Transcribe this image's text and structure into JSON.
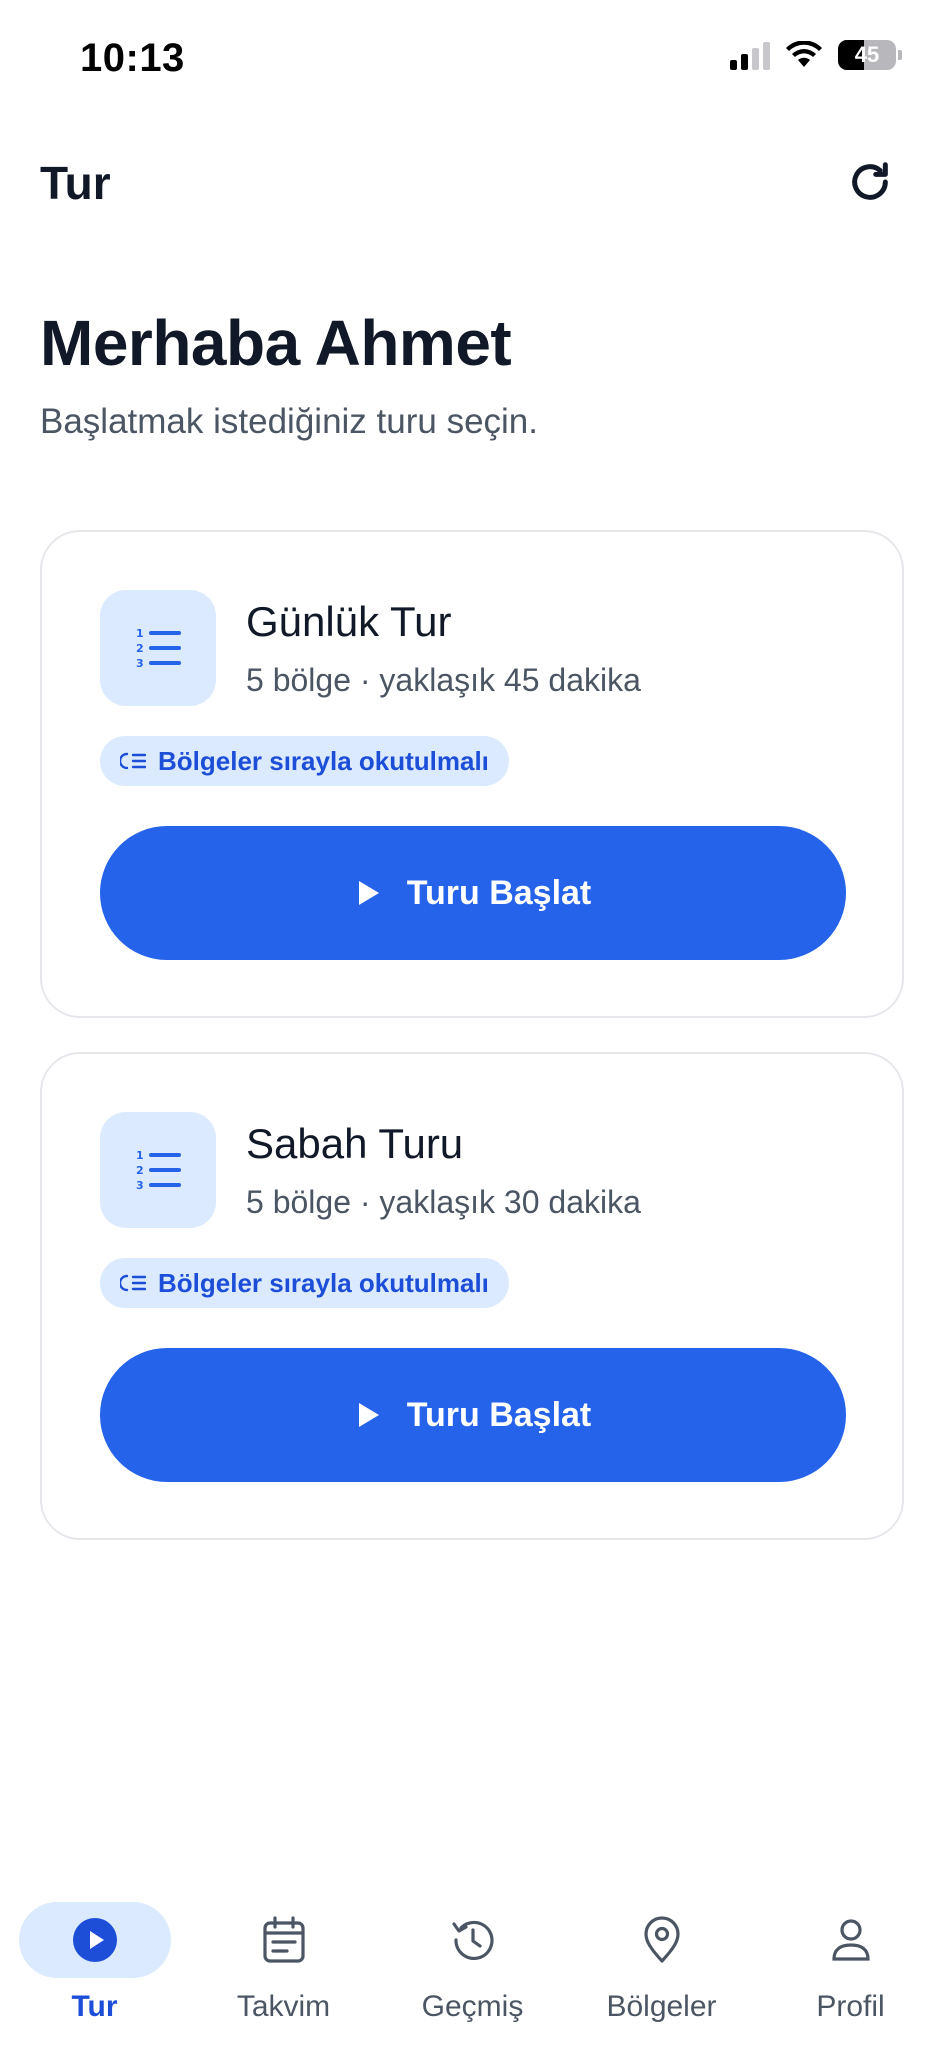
{
  "status_bar": {
    "time": "10:13",
    "battery_level": "45",
    "battery_fraction": 0.45,
    "signal_bars_active": 2,
    "signal_bars_total": 4
  },
  "header": {
    "title": "Tur",
    "refresh_icon": "refresh-icon"
  },
  "greeting": {
    "title": "Merhaba Ahmet",
    "subtitle": "Başlatmak istediğiniz turu seçin."
  },
  "tours": [
    {
      "name": "Günlük Tur",
      "meta": "5 bölge · yaklaşık 45 dakika",
      "icon": "numbered-list-icon",
      "badge": "Bölgeler sırayla okutulmalı",
      "badge_icon": "ordered-check-icon",
      "button_label": "Turu Başlat",
      "button_icon": "play-icon"
    },
    {
      "name": "Sabah Turu",
      "meta": "5 bölge · yaklaşık 30 dakika",
      "icon": "numbered-list-icon",
      "badge": "Bölgeler sırayla okutulmalı",
      "badge_icon": "ordered-check-icon",
      "button_label": "Turu Başlat",
      "button_icon": "play-icon"
    }
  ],
  "bottom_nav": {
    "items": [
      {
        "label": "Tur",
        "icon": "play-circle-icon",
        "active": true
      },
      {
        "label": "Takvim",
        "icon": "calendar-icon",
        "active": false
      },
      {
        "label": "Geçmiş",
        "icon": "history-icon",
        "active": false
      },
      {
        "label": "Bölgeler",
        "icon": "map-pin-icon",
        "active": false
      },
      {
        "label": "Profil",
        "icon": "user-icon",
        "active": false
      }
    ]
  },
  "colors": {
    "primary": "#2563eb",
    "primary_light": "#dbeafe",
    "primary_dark": "#1d4ed8",
    "text": "#111827",
    "muted": "#4b5563",
    "border": "#e5e7eb"
  }
}
